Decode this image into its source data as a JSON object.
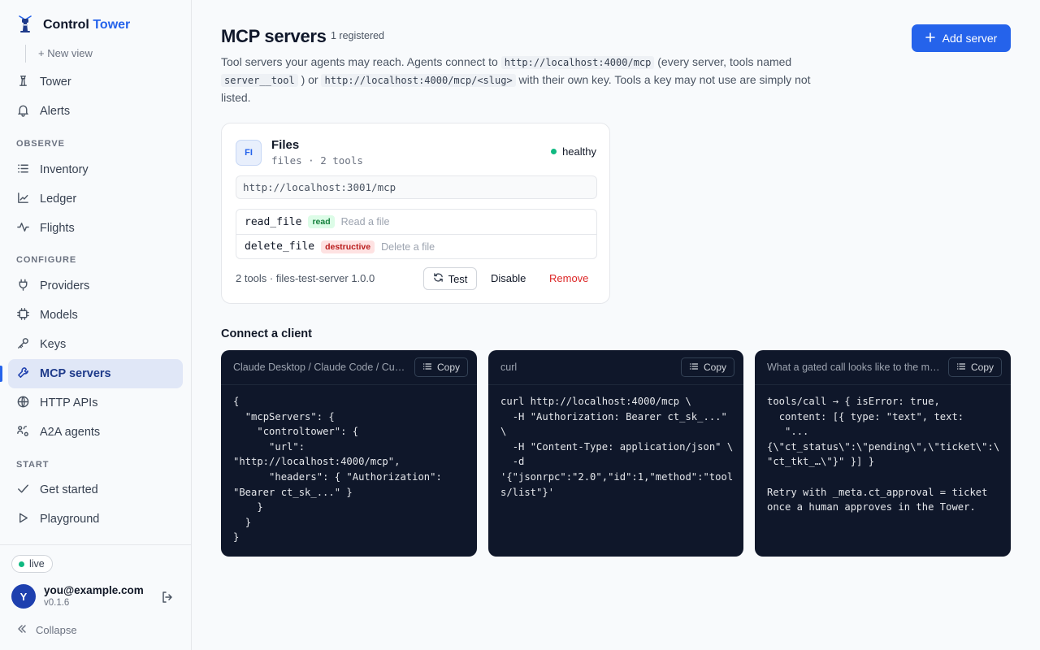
{
  "brand": {
    "name": "Control",
    "accent": "Tower",
    "accent_color": "#2563eb",
    "icon": "tower-icon"
  },
  "sidebar": {
    "new_view": "+ New view",
    "top_items": [
      {
        "label": "Tower",
        "icon": "tower-icon"
      },
      {
        "label": "Alerts",
        "icon": "bell-icon"
      }
    ],
    "sections": [
      {
        "label": "OBSERVE",
        "items": [
          {
            "label": "Inventory",
            "icon": "list-icon"
          },
          {
            "label": "Ledger",
            "icon": "line-chart-icon"
          },
          {
            "label": "Flights",
            "icon": "activity-icon"
          }
        ]
      },
      {
        "label": "CONFIGURE",
        "items": [
          {
            "label": "Providers",
            "icon": "plug-icon"
          },
          {
            "label": "Models",
            "icon": "cpu-icon"
          },
          {
            "label": "Keys",
            "icon": "key-icon"
          },
          {
            "label": "MCP servers",
            "icon": "wrench-icon",
            "active": true
          },
          {
            "label": "HTTP APIs",
            "icon": "globe-icon"
          },
          {
            "label": "A2A agents",
            "icon": "agents-icon"
          }
        ]
      },
      {
        "label": "START",
        "items": [
          {
            "label": "Get started",
            "icon": "check-icon"
          },
          {
            "label": "Playground",
            "icon": "play-icon"
          }
        ]
      }
    ],
    "footer": {
      "status": "live",
      "avatar_initial": "Y",
      "email": "you@example.com",
      "version": "v0.1.6",
      "collapse": "Collapse"
    }
  },
  "page": {
    "title": "MCP servers",
    "count": "1 registered",
    "add_button": "Add server",
    "description": {
      "t1": "Tool servers your agents may reach. Agents connect to ",
      "c1": "http://localhost:4000/mcp",
      "t2": " (every server, tools named ",
      "c2": "server__tool",
      "t3": " ) or ",
      "c3": "http://localhost:4000/mcp/<slug>",
      "t4": " with their own key. Tools a key may not use are simply not listed."
    }
  },
  "server": {
    "initials": "FI",
    "name": "Files",
    "meta": "files · 2 tools",
    "status": "healthy",
    "status_color": "#10b981",
    "url": "http://localhost:3001/mcp",
    "tools": [
      {
        "name": "read_file",
        "badge": "read",
        "desc": "Read a file"
      },
      {
        "name": "delete_file",
        "badge": "destructive",
        "desc": "Delete a file"
      }
    ],
    "footer": "2 tools · files-test-server 1.0.0",
    "test": "Test",
    "disable": "Disable",
    "remove": "Remove"
  },
  "connect": {
    "title": "Connect a client",
    "copy_label": "Copy",
    "panels": [
      {
        "label": "Claude Desktop / Claude Code / Cursor",
        "code": "{\n  \"mcpServers\": {\n    \"controltower\": {\n      \"url\":\n\"http://localhost:4000/mcp\",\n      \"headers\": { \"Authorization\":\n\"Bearer ct_sk_...\" }\n    }\n  }\n}"
      },
      {
        "label": "curl",
        "code": "curl http://localhost:4000/mcp \\\n  -H \"Authorization: Bearer ct_sk_...\"\n\\\n  -H \"Content-Type: application/json\" \\\n  -d\n'{\"jsonrpc\":\"2.0\",\"id\":1,\"method\":\"tools/list\"}'"
      },
      {
        "label": "What a gated call looks like to the model",
        "code": "tools/call → { isError: true,\n  content: [{ type: \"text\", text:\n   \"...\n{\\\"ct_status\\\":\\\"pending\\\",\\\"ticket\\\":\\\n\"ct_tkt_…\\\"}\" }] }\n\nRetry with _meta.ct_approval = ticket\nonce a human approves in the Tower."
      }
    ]
  }
}
